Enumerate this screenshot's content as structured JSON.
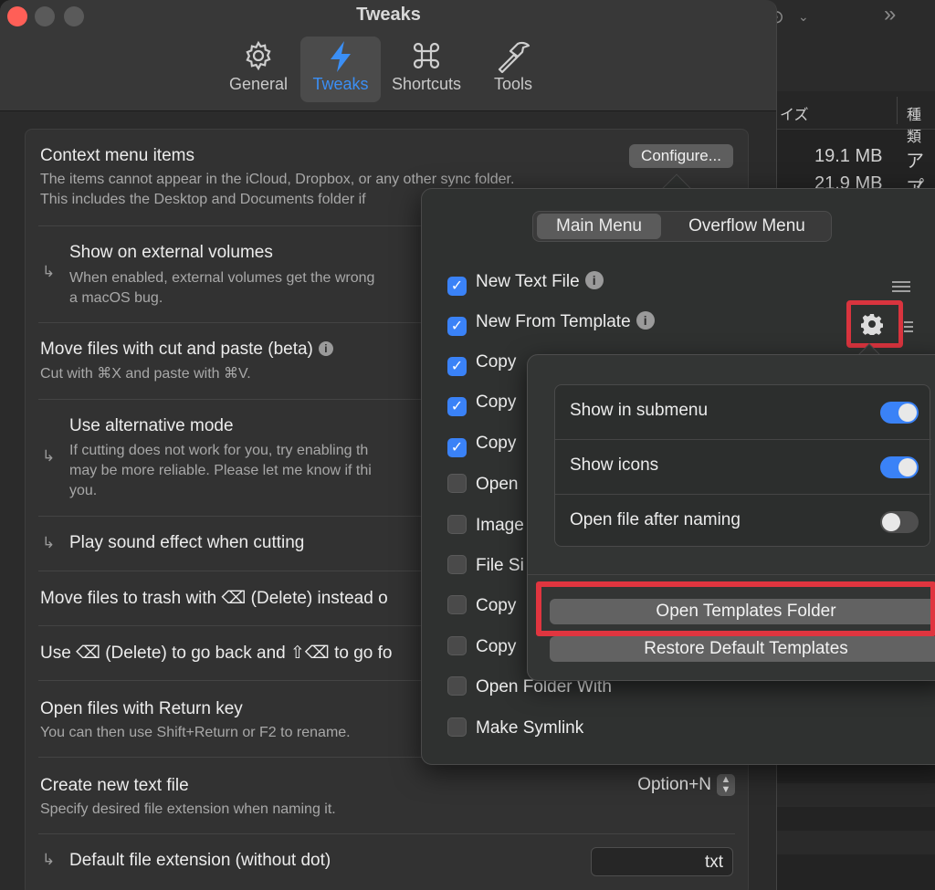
{
  "window": {
    "title": "Tweaks"
  },
  "colors": {
    "accent": "#3a82f7",
    "highlight": "#e0353f",
    "close": "#ff5f57"
  },
  "tabs": [
    {
      "label": "General",
      "icon": "gear-icon"
    },
    {
      "label": "Tweaks",
      "icon": "bolt-icon",
      "selected": true
    },
    {
      "label": "Shortcuts",
      "icon": "command-icon"
    },
    {
      "label": "Tools",
      "icon": "hammer-icon"
    }
  ],
  "settings": {
    "context_menu": {
      "title": "Context menu items",
      "desc1": "The items cannot appear in the iCloud, Dropbox, or any other sync folder.",
      "desc2": "This includes the Desktop and Documents folder if",
      "button": "Configure..."
    },
    "external_volumes": {
      "title": "Show on external volumes",
      "desc1": "When enabled, external volumes get the wrong",
      "desc2": "a macOS bug."
    },
    "cut_paste": {
      "title": "Move files with cut and paste (beta)",
      "desc": "Cut with ⌘X and paste with ⌘V."
    },
    "alt_mode": {
      "title": "Use alternative mode",
      "desc1": "If cutting does not work for you, try enabling th",
      "desc2": "may be more reliable. Please let me know if thi",
      "desc3": "you."
    },
    "sound": {
      "title": "Play sound effect when cutting"
    },
    "trash": {
      "title": "Move files to trash with ⌫ (Delete) instead o"
    },
    "back_forward": {
      "title": "Use ⌫ (Delete) to go back and ⇧⌫ to go fo"
    },
    "return_key": {
      "title": "Open files with Return key",
      "desc": "You can then use Shift+Return or F2 to rename."
    },
    "new_text": {
      "title": "Create new text file",
      "desc": "Specify desired file extension when naming it.",
      "shortcut": "Option+N"
    },
    "default_ext": {
      "title": "Default file extension (without dot)",
      "value": "txt"
    }
  },
  "popover": {
    "segments": [
      "Main Menu",
      "Overflow Menu"
    ],
    "selected_segment": "Main Menu",
    "items": [
      {
        "label": "New Text File",
        "checked": true,
        "info": true
      },
      {
        "label": "New From Template",
        "checked": true,
        "info": true
      },
      {
        "label": "Copy ",
        "checked": true
      },
      {
        "label": "Copy",
        "checked": true
      },
      {
        "label": "Copy",
        "checked": true
      },
      {
        "label": "Open",
        "checked": false
      },
      {
        "label": "Image",
        "checked": false
      },
      {
        "label": "File Si",
        "checked": false
      },
      {
        "label": "Copy",
        "checked": false
      },
      {
        "label": "Copy",
        "checked": false
      },
      {
        "label": "Open Folder With",
        "checked": false
      },
      {
        "label": "Make Symlink",
        "checked": false
      }
    ]
  },
  "template_options": {
    "toggles": [
      {
        "label": "Show in submenu",
        "on": true
      },
      {
        "label": "Show icons",
        "on": true
      },
      {
        "label": "Open file after naming",
        "on": false
      }
    ],
    "open_folder": "Open Templates Folder",
    "restore": "Restore Default Templates"
  },
  "background": {
    "columns": [
      "イズ",
      "種類"
    ],
    "rows": [
      {
        "size": "19.1 MB",
        "kind": "アプ"
      },
      {
        "size": "21.9 MB",
        "kind": "アプ"
      }
    ]
  }
}
